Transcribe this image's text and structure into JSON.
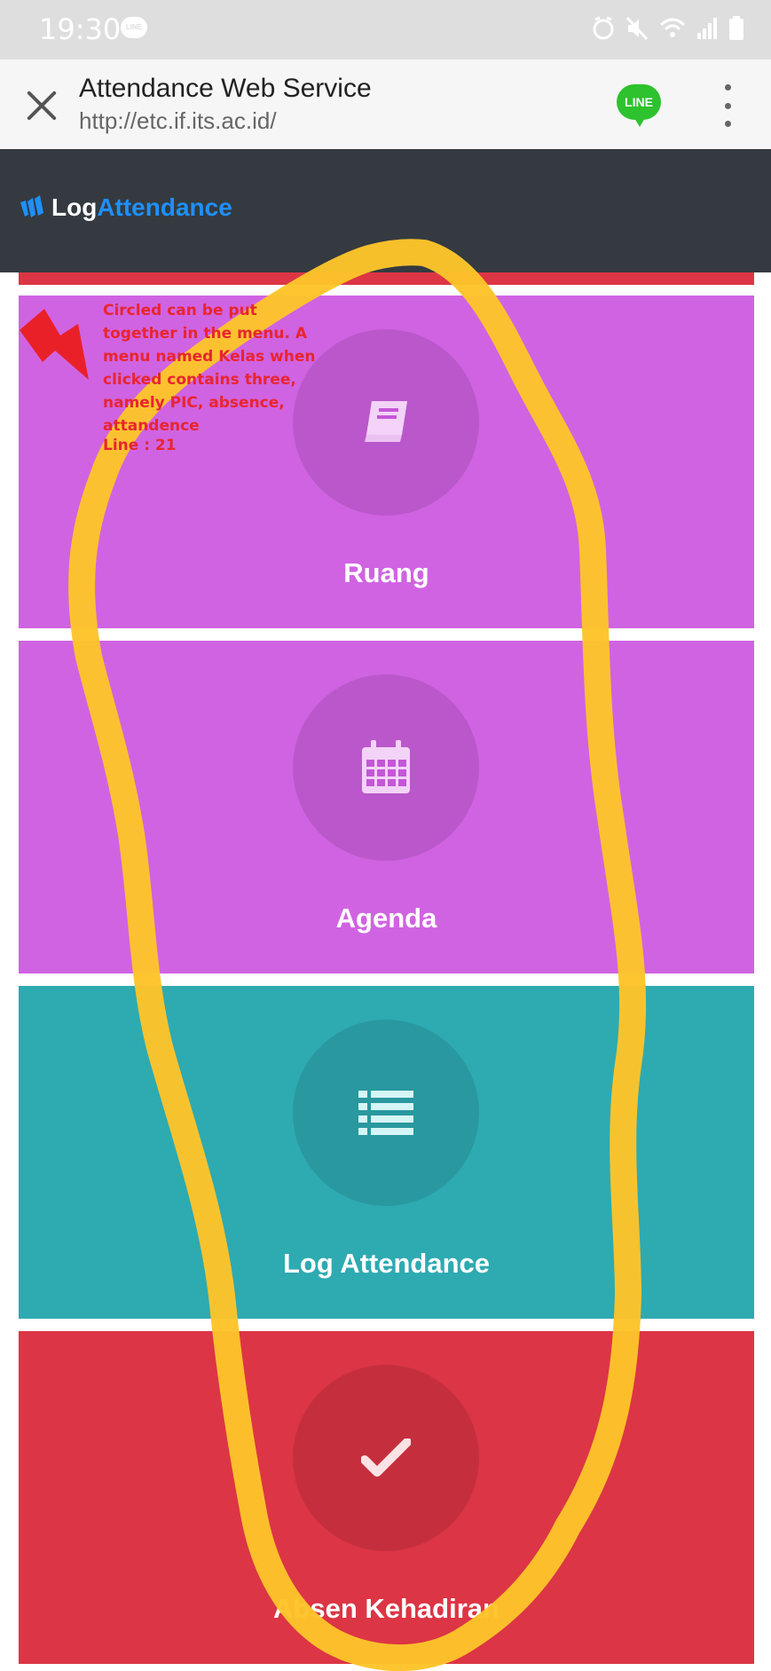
{
  "status_bar": {
    "time": "19:30",
    "line_notif": "LINE",
    "icons": [
      "alarm-icon",
      "mute-icon",
      "wifi-icon",
      "signal-icon",
      "battery-icon"
    ]
  },
  "browser": {
    "title": "Attendance Web Service",
    "url": "http://etc.if.its.ac.id/",
    "line_button": "LINE"
  },
  "app": {
    "brand_log": "Log",
    "brand_attendance": "Attendance"
  },
  "tiles": [
    {
      "label": "Ruang",
      "icon": "book-icon",
      "color": "#d063e2"
    },
    {
      "label": "Agenda",
      "icon": "calendar-icon",
      "color": "#d063e2"
    },
    {
      "label": "Log Attendance",
      "icon": "list-icon",
      "color": "#2eaab1"
    },
    {
      "label": "Absen Kehadiran",
      "icon": "check-icon",
      "color": "#dc3545"
    }
  ],
  "annotation": {
    "text": "Circled can be put together in the menu. A menu named Kelas when clicked contains three, namely PIC, absence, attandence",
    "line_label": "Line : 21",
    "color": "#e8252f",
    "highlight_color": "#fdc42a"
  }
}
